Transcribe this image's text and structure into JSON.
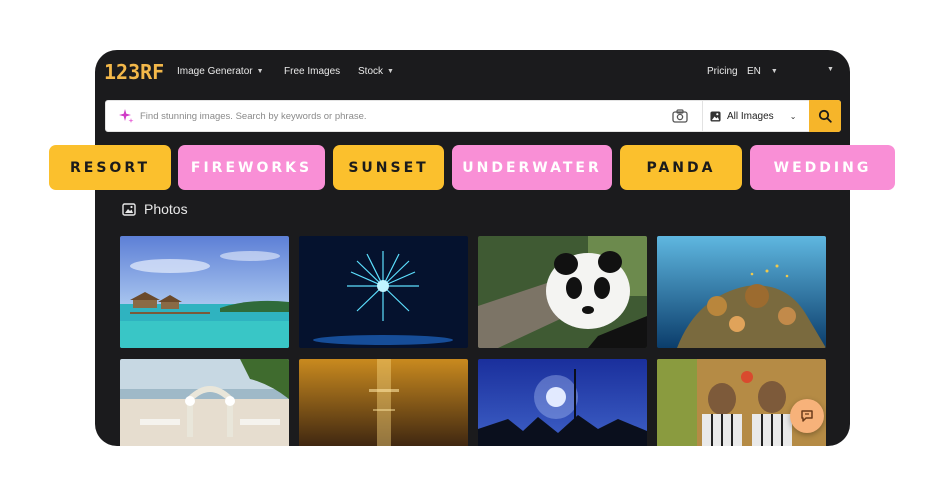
{
  "brand": {
    "logo": "123RF",
    "accent": "#f6b52a",
    "pink": "#f98fd6"
  },
  "nav": {
    "image_generator": "Image Generator",
    "free_images": "Free Images",
    "stock": "Stock",
    "pricing": "Pricing",
    "language": "EN"
  },
  "search": {
    "placeholder": "Find stunning images. Search by keywords or phrase.",
    "value": "",
    "type_selected": "All Images"
  },
  "section": {
    "title": "Photos"
  },
  "chips": [
    {
      "label": "RESORT",
      "style": "yellow"
    },
    {
      "label": "FIREWORKS",
      "style": "pink"
    },
    {
      "label": "SUNSET",
      "style": "yellow"
    },
    {
      "label": "UNDERWATER",
      "style": "pink"
    },
    {
      "label": "PANDA",
      "style": "yellow"
    },
    {
      "label": "WEDDING",
      "style": "pink"
    }
  ],
  "photos": [
    {
      "subject": "tropical-resort"
    },
    {
      "subject": "fireworks"
    },
    {
      "subject": "panda"
    },
    {
      "subject": "coral-reef"
    },
    {
      "subject": "beach-wedding-arch"
    },
    {
      "subject": "sunset-sea"
    },
    {
      "subject": "silhouette-night"
    },
    {
      "subject": "masked-dancers"
    }
  ],
  "icons": {
    "sparkle": "sparkle-icon",
    "camera": "camera-icon",
    "image": "image-icon",
    "search": "search-icon",
    "chat": "chat-icon"
  }
}
